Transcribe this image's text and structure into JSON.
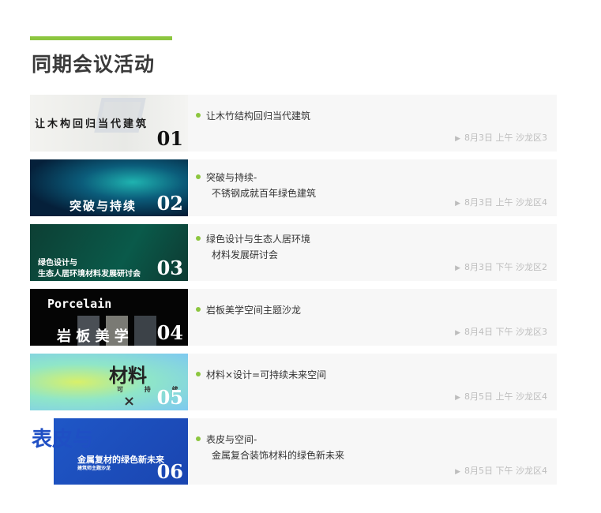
{
  "section": {
    "title": "同期会议活动"
  },
  "colors": {
    "accent": "#8cc63f",
    "card_bg": "#f7f7f7",
    "meta_text": "#bdbdbd"
  },
  "events": [
    {
      "num": "01",
      "thumb_text": "让木构回归当代建筑",
      "title_line1": "让木竹结构回归当代建筑",
      "title_line2": "",
      "meta": "8月3日 上午 沙龙区3"
    },
    {
      "num": "02",
      "thumb_text": "突破与持续",
      "title_line1": "突破与持续-",
      "title_line2": "不锈钢成就百年绿色建筑",
      "meta": "8月3日 上午 沙龙区4"
    },
    {
      "num": "03",
      "thumb_text": "绿色设计与",
      "thumb_text2": "生态人居环境材料发展研讨会",
      "title_line1": "绿色设计与生态人居环境",
      "title_line2": "材料发展研讨会",
      "meta": "8月3日 下午 沙龙区2"
    },
    {
      "num": "04",
      "thumb_text": "Porcelain",
      "thumb_text2": "岩 板 美 学",
      "title_line1": "岩板美学空间主题沙龙",
      "title_line2": "",
      "meta": "8月4日 下午 沙龙区3"
    },
    {
      "num": "05",
      "thumb_text": "材料",
      "thumb_text2": "可 持 续",
      "thumb_text3": "×",
      "title_line1": "材料×设计=可持续未来空间",
      "title_line2": "",
      "meta": "8月5日 上午 沙龙区4"
    },
    {
      "num": "06",
      "thumb_text": "表皮与",
      "thumb_text2": "金属复材的绿色新未来",
      "thumb_text3": "建筑师主题沙龙",
      "title_line1": "表皮与空间-",
      "title_line2": "金属复合装饰材料的绿色新未来",
      "meta": "8月5日 下午 沙龙区4"
    }
  ]
}
